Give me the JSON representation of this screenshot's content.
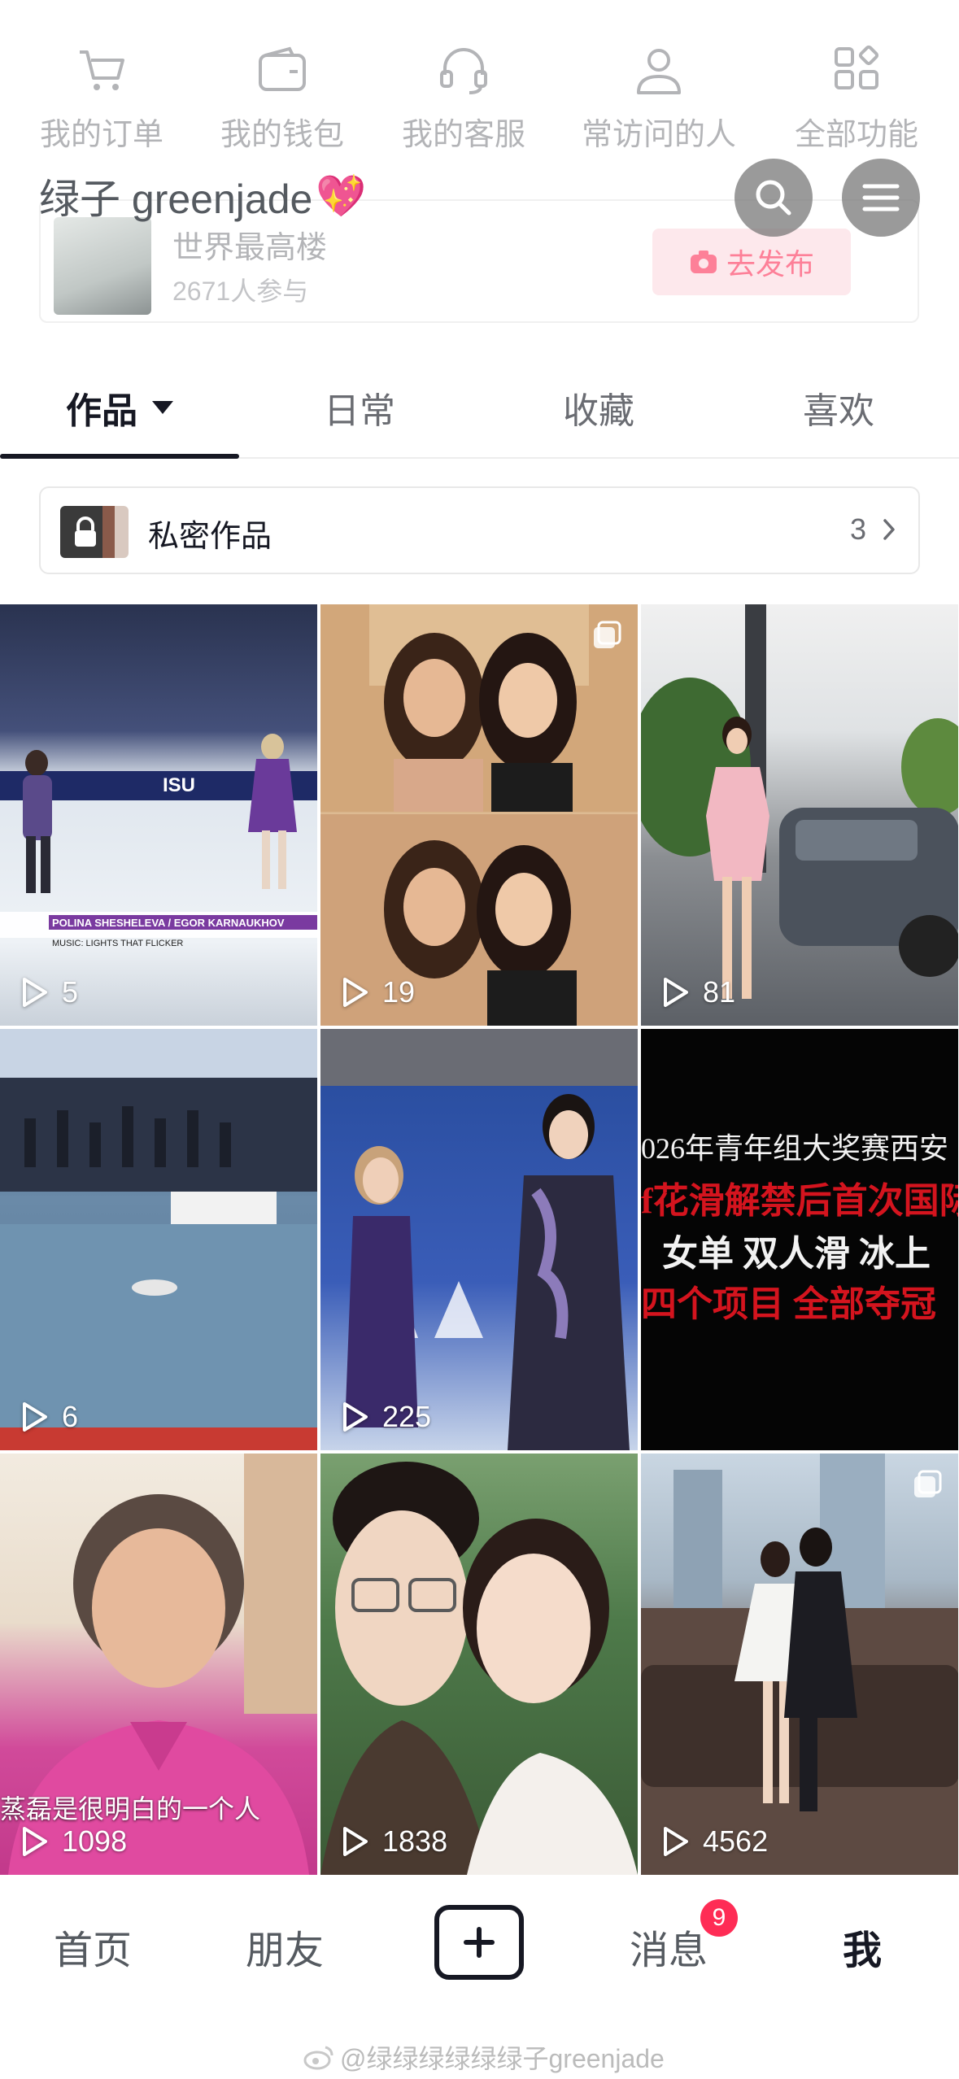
{
  "quick_actions": [
    {
      "label": "我的订单",
      "icon": "cart-icon"
    },
    {
      "label": "我的钱包",
      "icon": "wallet-icon"
    },
    {
      "label": "我的客服",
      "icon": "headset-icon"
    },
    {
      "label": "常访问的人",
      "icon": "person-icon"
    },
    {
      "label": "全部功能",
      "icon": "grid-icon"
    }
  ],
  "profile": {
    "username": "绿子 greenjade",
    "username_emoji": "💖"
  },
  "topic": {
    "title": "世界最高楼",
    "participants": "2671人参与",
    "publish_label": "去发布"
  },
  "tabs": [
    {
      "label": "作品",
      "active": true
    },
    {
      "label": "日常",
      "active": false
    },
    {
      "label": "收藏",
      "active": false
    },
    {
      "label": "喜欢",
      "active": false
    }
  ],
  "private_works": {
    "label": "私密作品",
    "count": "3"
  },
  "videos": [
    {
      "plays": "5",
      "multi": false
    },
    {
      "plays": "19",
      "multi": true
    },
    {
      "plays": "81",
      "multi": false
    },
    {
      "plays": "6",
      "multi": false
    },
    {
      "plays": "225",
      "multi": false
    },
    {
      "plays": "",
      "multi": false
    },
    {
      "plays": "1098",
      "multi": false
    },
    {
      "plays": "1838",
      "multi": false
    },
    {
      "plays": "4562",
      "multi": true
    }
  ],
  "video_texts": {
    "v1_caption1": "POLINA SHESHELEVA / EGOR KARNAUKHOV",
    "v1_caption2": "MUSIC: LIGHTS THAT FLICKER",
    "v1_logo": "ISU",
    "v6_line1": "026年青年组大奖赛西安",
    "v6_line2": "f花滑解禁后首次国际",
    "v6_line3": "女单  双人滑  冰上",
    "v6_line4": "四个项目  全部夺冠",
    "v7_subtitle": "蒸磊是很明白的一个人"
  },
  "bottom_nav": {
    "home": "首页",
    "friends": "朋友",
    "messages": "消息",
    "me": "我",
    "message_badge": "9"
  },
  "watermark": "@绿绿绿绿绿绿子greenjade",
  "colors": {
    "accent": "#fe2c55",
    "text": "#161823",
    "muted": "#6a6c72"
  }
}
